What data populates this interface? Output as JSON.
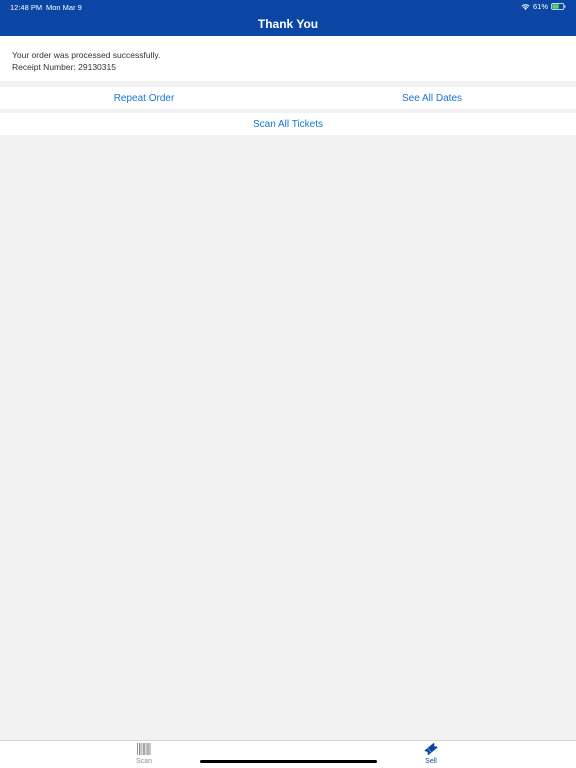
{
  "status_bar": {
    "time": "12:48 PM",
    "date": "Mon Mar 9",
    "battery_percent": "61%",
    "wifi_icon": "wifi-icon",
    "battery_icon": "battery-icon",
    "battery_level": 0.61
  },
  "nav": {
    "title": "Thank You"
  },
  "message": {
    "line1": "Your order was processed successfully.",
    "line2": "Receipt Number: 29130315"
  },
  "actions": {
    "repeat_order": "Repeat Order",
    "see_all_dates": "See All Dates",
    "scan_all_tickets": "Scan All Tickets"
  },
  "tab_bar": {
    "items": [
      {
        "label": "Scan",
        "icon": "barcode-icon",
        "selected": false
      },
      {
        "label": "Sell",
        "icon": "ticket-icon",
        "selected": true
      }
    ]
  },
  "colors": {
    "header_bg": "#0c46a4",
    "link": "#1a75d1",
    "page_bg": "#f2f2f2",
    "tab_inactive": "#8e8e93",
    "tab_active": "#0c46a4"
  }
}
